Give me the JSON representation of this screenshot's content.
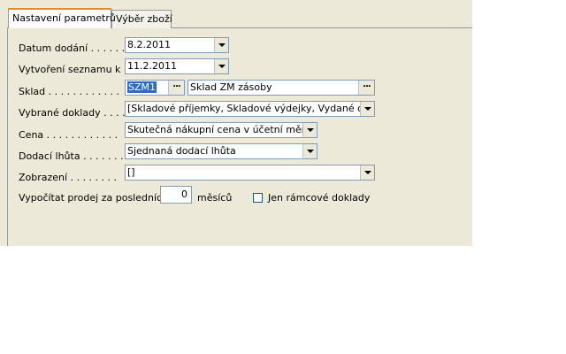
{
  "tabs": [
    {
      "label": "Nastavení parametrů",
      "active": true
    },
    {
      "label": "Výběr zboží",
      "active": false
    }
  ],
  "fields": {
    "datum_dodani": {
      "label": "Datum dodání . . . . . .",
      "value": "8.2.2011"
    },
    "vytvoreni_seznamu": {
      "label": "Vytvoření seznamu k .",
      "value": "11.2.2011"
    },
    "sklad": {
      "label": "Sklad . . . . . . . . . . . .",
      "code": "SZM1",
      "name": "Sklad ZM zásoby"
    },
    "vybrane_doklady": {
      "label": "Vybrané doklady . . . .",
      "value": "[Skladové příjemky, Skladové výdejky, Vydané objedná"
    },
    "cena": {
      "label": "Cena . . . . . . . . . . . .",
      "value": "Skutečná nákupní cena v účetní měně"
    },
    "dodaci_lhuta": {
      "label": "Dodací lhůta . . . . . . .",
      "value": "Sjednaná dodací lhůta"
    },
    "zobrazeni": {
      "label": "Zobrazení . . . . . . . .",
      "value": "[]"
    },
    "vypocitat": {
      "label": "Vypočítat prodej za posledních",
      "value": "0",
      "unit": "měsíců"
    },
    "ramcove": {
      "label": "Jen rámcové doklady",
      "checked": false
    }
  },
  "ellipsis": "..."
}
